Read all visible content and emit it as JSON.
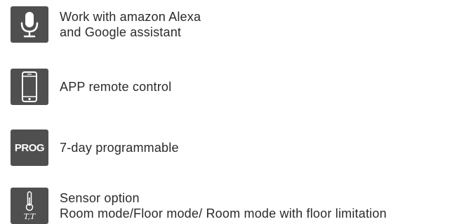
{
  "features": [
    {
      "icon": "microphone-icon",
      "lines": [
        "Work with amazon Alexa",
        "and Google assistant"
      ]
    },
    {
      "icon": "smartphone-icon",
      "lines": [
        "APP remote control"
      ]
    },
    {
      "icon": "prog-icon",
      "icon_text": "PROG",
      "lines": [
        "7-day programmable"
      ]
    },
    {
      "icon": "temperature-sensor-icon",
      "icon_text": "T,T",
      "lines": [
        "Sensor option",
        "Room mode/Floor mode/ Room mode with floor limitation"
      ]
    }
  ],
  "colors": {
    "icon_background": "#4f4f4f",
    "icon_foreground": "#ffffff",
    "text": "#2b2b2b"
  }
}
